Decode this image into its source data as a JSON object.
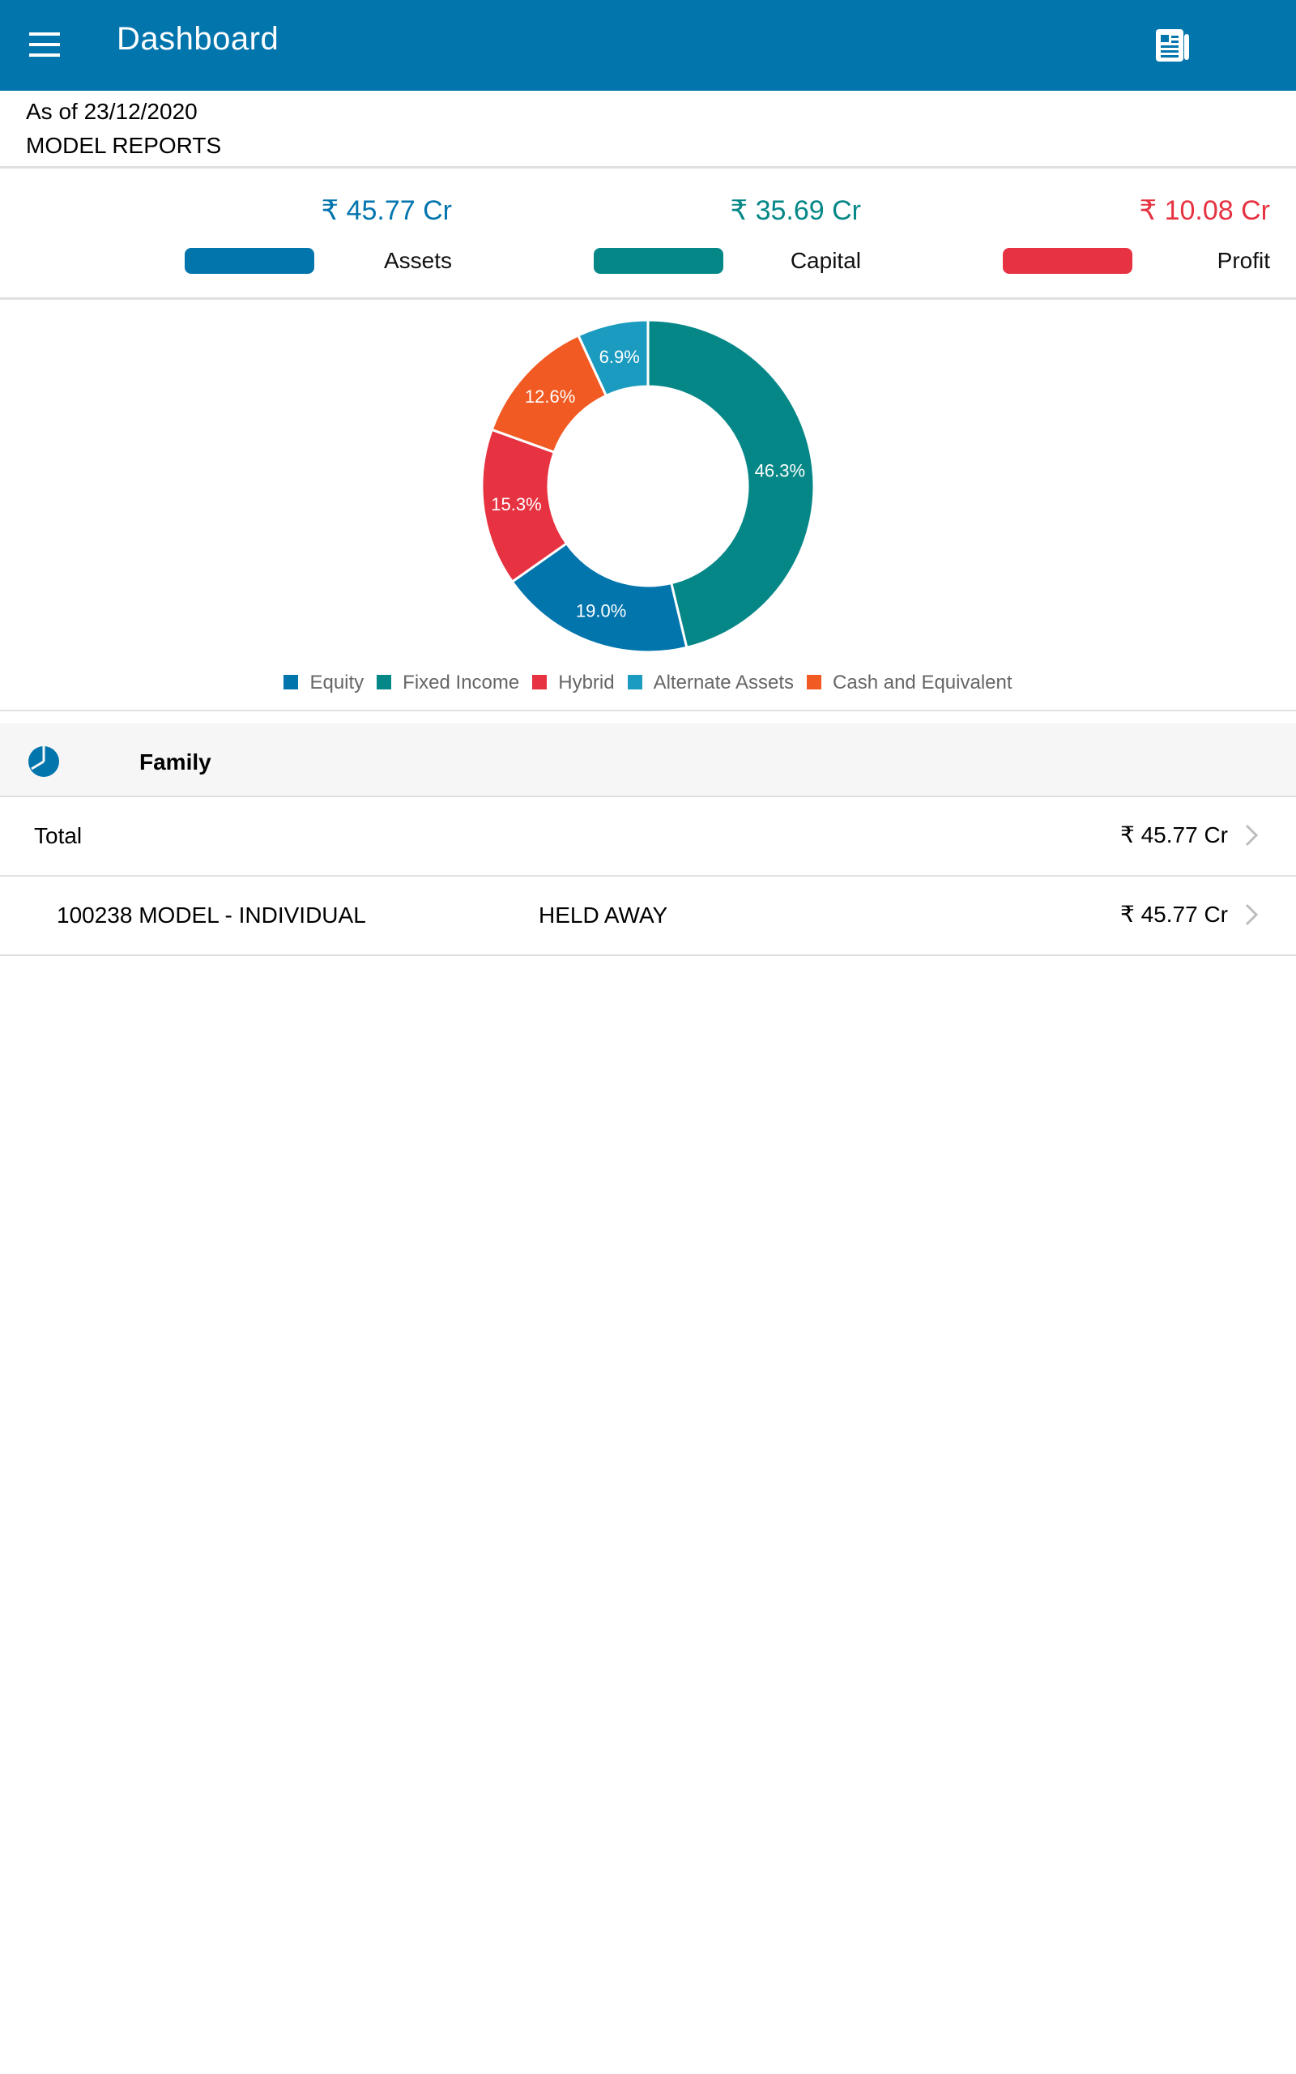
{
  "appbar": {
    "title": "Dashboard",
    "menu_icon": "hamburger-menu-icon",
    "action_icon": "newspaper-report-icon",
    "color": "#0275ad"
  },
  "info": {
    "as_of": "As of 23/12/2020",
    "subtitle": "MODEL REPORTS"
  },
  "summary": [
    {
      "value": "₹ 45.77 Cr",
      "label": "Assets",
      "color": "#0275ad"
    },
    {
      "value": "₹ 35.69 Cr",
      "label": "Capital",
      "color": "#068787"
    },
    {
      "value": "₹ 10.08 Cr",
      "label": "Profit",
      "color": "#e63241"
    }
  ],
  "chart_data": {
    "type": "pie",
    "donut": true,
    "title": "",
    "start": "top",
    "direction": "clockwise",
    "legend_position": "bottom",
    "slices": [
      {
        "name": "Fixed Income",
        "value": 46.3,
        "label": "46.3%",
        "color": "#068787"
      },
      {
        "name": "Equity",
        "value": 19.0,
        "label": "19.0%",
        "color": "#0275ad"
      },
      {
        "name": "Hybrid",
        "value": 15.3,
        "label": "15.3%",
        "color": "#e63241"
      },
      {
        "name": "Cash and Equivalent",
        "value": 12.6,
        "label": "12.6%",
        "color": "#f15a22"
      },
      {
        "name": "Alternate Assets",
        "value": 6.9,
        "label": "6.9%",
        "color": "#1c9bc0"
      }
    ],
    "legend": [
      {
        "name": "Equity",
        "color": "#0275ad"
      },
      {
        "name": "Fixed Income",
        "color": "#068787"
      },
      {
        "name": "Hybrid",
        "color": "#e63241"
      },
      {
        "name": "Alternate Assets",
        "color": "#1c9bc0"
      },
      {
        "name": "Cash and Equivalent",
        "color": "#f15a22"
      }
    ]
  },
  "family": {
    "icon": "pie-chart-icon",
    "title": "Family"
  },
  "rows": [
    {
      "name": "Total",
      "type": "",
      "amount": "₹ 45.77 Cr"
    },
    {
      "name": "100238 MODEL - INDIVIDUAL",
      "type": "HELD AWAY",
      "amount": "₹ 45.77 Cr"
    }
  ]
}
